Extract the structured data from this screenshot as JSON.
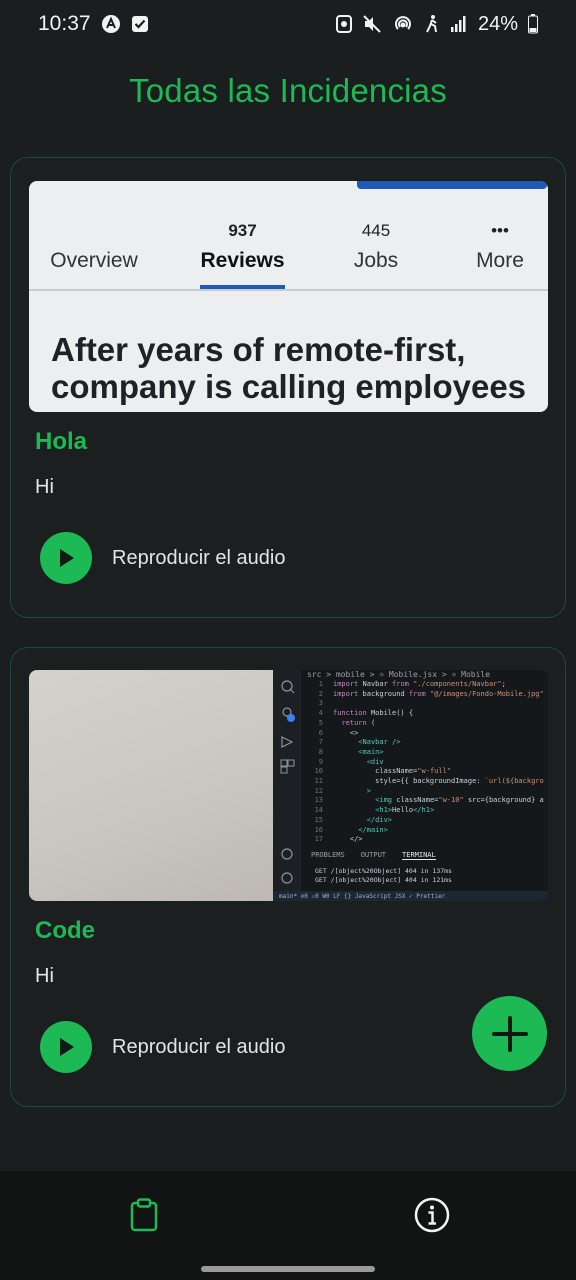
{
  "status_bar": {
    "time": "10:37",
    "battery": "24%",
    "icons_left": [
      "app-notification-icon",
      "checkbox-notification-icon"
    ],
    "icons_right": [
      "nfc-icon",
      "mute-icon",
      "hotspot-icon",
      "signal-bars-icon",
      "battery-icon"
    ]
  },
  "header": {
    "title": "Todas las Incidencias"
  },
  "incidents": [
    {
      "title": "Hola",
      "description": "Hi",
      "audio_label": "Reproducir el audio",
      "image": {
        "tabs": [
          {
            "count": "",
            "label": "Overview"
          },
          {
            "count": "937",
            "label": "Reviews",
            "active": true
          },
          {
            "count": "445",
            "label": "Jobs"
          },
          {
            "count": "•••",
            "label": "More"
          }
        ],
        "headline_line1": "After years of remote-first,",
        "headline_line2": "company is calling employees"
      }
    },
    {
      "title": "Code",
      "description": "Hi",
      "audio_label": "Reproducir el audio",
      "image": {
        "breadcrumb": "src > mobile > ⚛ Mobile.jsx > ⚛ Mobile",
        "panel_tabs": [
          "PROBLEMS",
          "OUTPUT",
          "TERMINAL"
        ],
        "terminal_line1": "GET /[object%20Object] 404 in 137ms",
        "terminal_line2": "GET /[object%20Object] 404 in 121ms",
        "status": "main*   ⊘0 ⚠0   W0       LF   {} JavaScript JSX   ✓ Prettier"
      }
    }
  ],
  "fab": {
    "icon": "plus-icon"
  },
  "bottom_nav": {
    "items": [
      {
        "icon": "clipboard-icon",
        "active": true
      },
      {
        "icon": "info-icon",
        "active": false
      }
    ]
  },
  "colors": {
    "accent": "#1db954",
    "background": "#1b1e1e",
    "nav_background": "#121414"
  }
}
